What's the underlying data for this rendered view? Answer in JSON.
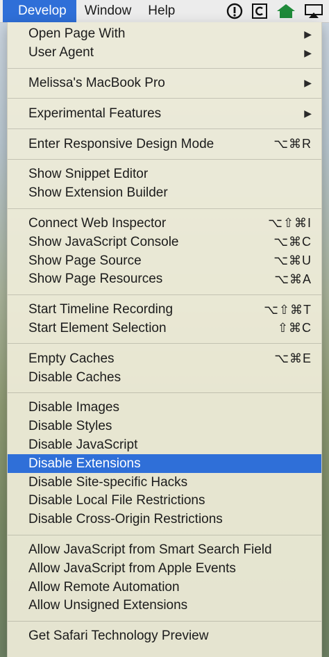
{
  "menubar": {
    "items": [
      "Develop",
      "Window",
      "Help"
    ],
    "icons": [
      "info-circle-icon",
      "c-box-icon",
      "home-icon",
      "airplay-icon"
    ]
  },
  "menu": {
    "groups": [
      [
        {
          "label": "Open Page With",
          "submenu": true,
          "shortcut": ""
        },
        {
          "label": "User Agent",
          "submenu": true,
          "shortcut": ""
        }
      ],
      [
        {
          "label": "Melissa's MacBook Pro",
          "submenu": true,
          "shortcut": ""
        }
      ],
      [
        {
          "label": "Experimental Features",
          "submenu": true,
          "shortcut": ""
        }
      ],
      [
        {
          "label": "Enter Responsive Design Mode",
          "submenu": false,
          "shortcut": "⌥⌘R"
        }
      ],
      [
        {
          "label": "Show Snippet Editor",
          "submenu": false,
          "shortcut": ""
        },
        {
          "label": "Show Extension Builder",
          "submenu": false,
          "shortcut": ""
        }
      ],
      [
        {
          "label": "Connect Web Inspector",
          "submenu": false,
          "shortcut": "⌥⇧⌘I"
        },
        {
          "label": "Show JavaScript Console",
          "submenu": false,
          "shortcut": "⌥⌘C"
        },
        {
          "label": "Show Page Source",
          "submenu": false,
          "shortcut": "⌥⌘U"
        },
        {
          "label": "Show Page Resources",
          "submenu": false,
          "shortcut": "⌥⌘A"
        }
      ],
      [
        {
          "label": "Start Timeline Recording",
          "submenu": false,
          "shortcut": "⌥⇧⌘T"
        },
        {
          "label": "Start Element Selection",
          "submenu": false,
          "shortcut": "⇧⌘C"
        }
      ],
      [
        {
          "label": "Empty Caches",
          "submenu": false,
          "shortcut": "⌥⌘E"
        },
        {
          "label": "Disable Caches",
          "submenu": false,
          "shortcut": ""
        }
      ],
      [
        {
          "label": "Disable Images",
          "submenu": false,
          "shortcut": ""
        },
        {
          "label": "Disable Styles",
          "submenu": false,
          "shortcut": ""
        },
        {
          "label": "Disable JavaScript",
          "submenu": false,
          "shortcut": ""
        },
        {
          "label": "Disable Extensions",
          "submenu": false,
          "shortcut": "",
          "selected": true
        },
        {
          "label": "Disable Site-specific Hacks",
          "submenu": false,
          "shortcut": ""
        },
        {
          "label": "Disable Local File Restrictions",
          "submenu": false,
          "shortcut": ""
        },
        {
          "label": "Disable Cross-Origin Restrictions",
          "submenu": false,
          "shortcut": ""
        }
      ],
      [
        {
          "label": "Allow JavaScript from Smart Search Field",
          "submenu": false,
          "shortcut": ""
        },
        {
          "label": "Allow JavaScript from Apple Events",
          "submenu": false,
          "shortcut": ""
        },
        {
          "label": "Allow Remote Automation",
          "submenu": false,
          "shortcut": ""
        },
        {
          "label": "Allow Unsigned Extensions",
          "submenu": false,
          "shortcut": ""
        }
      ],
      [
        {
          "label": "Get Safari Technology Preview",
          "submenu": false,
          "shortcut": ""
        }
      ]
    ]
  },
  "colors": {
    "selection": "#2f6fd8",
    "home_icon": "#1f8a3a"
  }
}
